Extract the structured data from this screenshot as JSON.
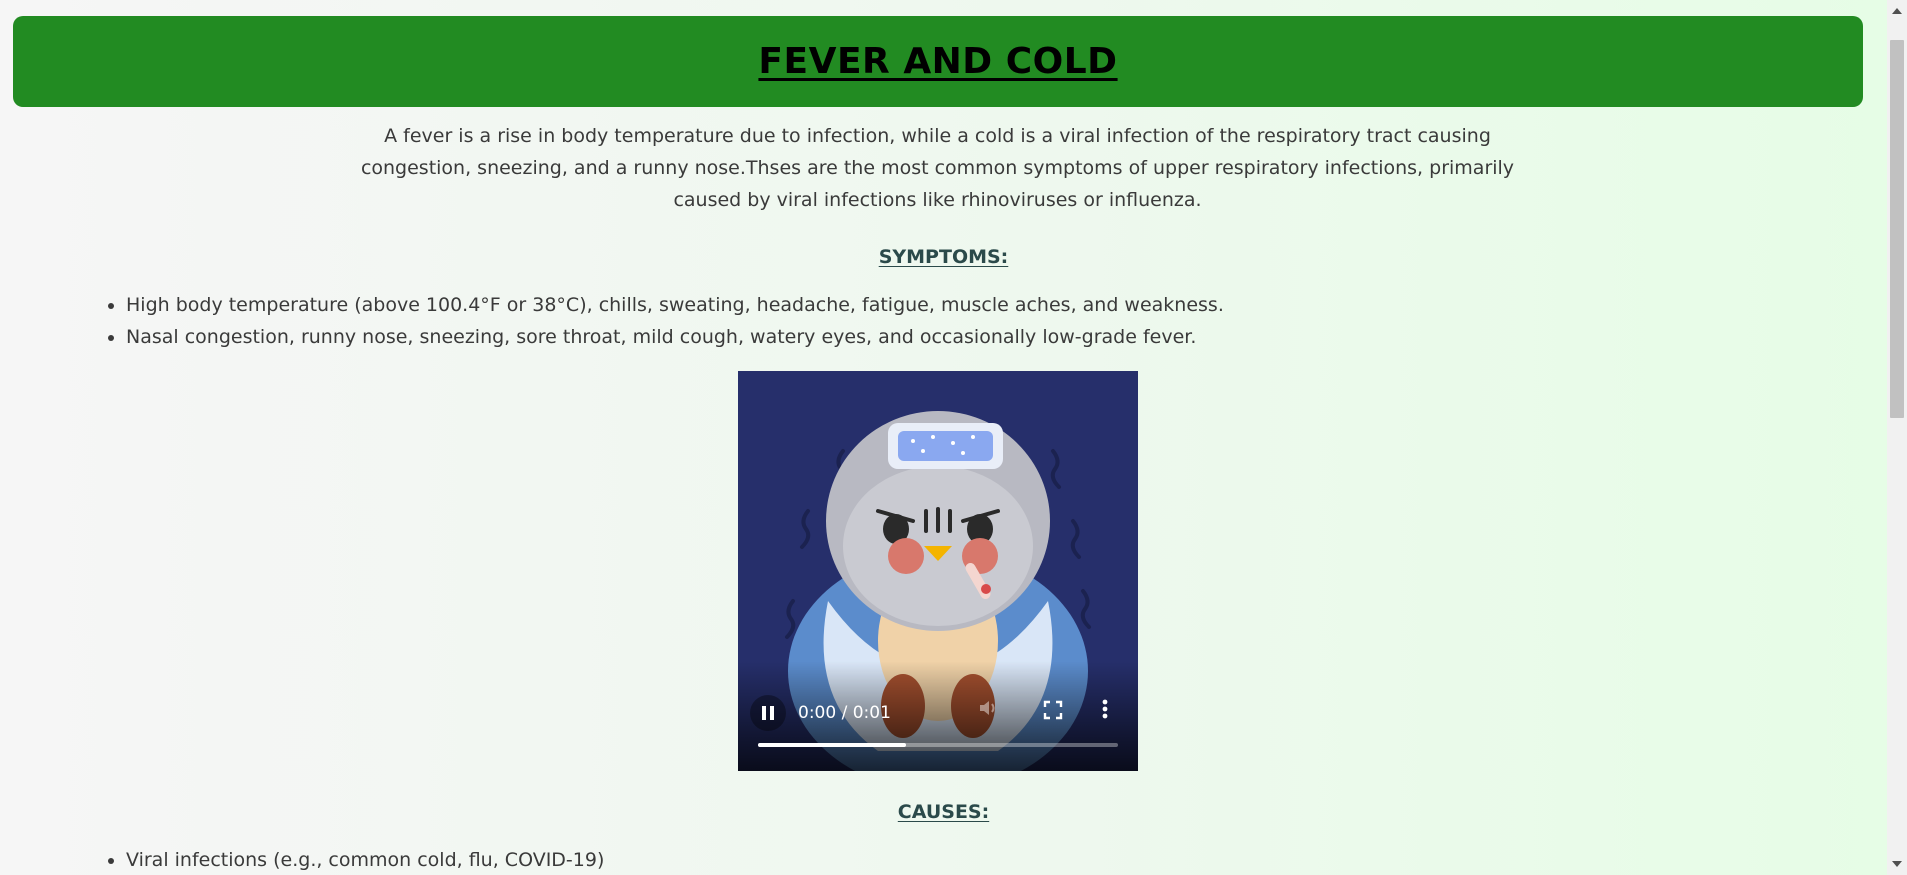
{
  "header": {
    "title": "FEVER AND COLD",
    "bg_color": "#228b22"
  },
  "intro": {
    "text": "A fever is a rise in body temperature due to infection, while a cold is a viral infection of the respiratory tract causing congestion, sneezing, and a runny nose.Thses are the most common symptoms of upper respiratory infections, primarily caused by viral infections like rhinoviruses or influenza."
  },
  "symptoms": {
    "title": "SYMPTOMS:",
    "items": [
      "High body temperature (above 100.4°F or 38°C), chills, sweating, headache, fatigue, muscle aches, and weakness.",
      "Nasal congestion, runny nose, sneezing, sore throat, mild cough, watery eyes, and occasionally low-grade fever."
    ]
  },
  "video": {
    "time": "0:00 / 0:01",
    "progress_fraction": 0.41,
    "pause_icon": "pause-icon",
    "mute_icon": "volume-icon",
    "fullscreen_icon": "fullscreen-icon",
    "more_icon": "more-vertical-icon",
    "bg_color": "#262f6b"
  },
  "causes": {
    "title": "CAUSES:",
    "items": [
      "Viral infections (e.g., common cold, flu, COVID-19)"
    ]
  }
}
